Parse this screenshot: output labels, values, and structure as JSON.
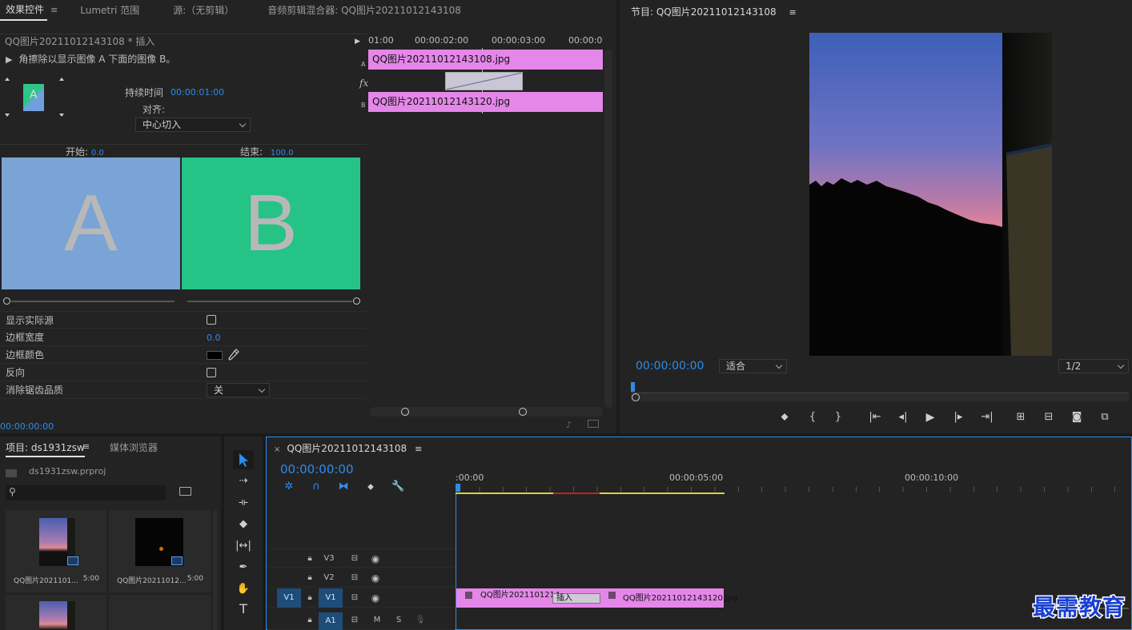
{
  "effect_panel": {
    "tabs": [
      "效果控件",
      "Lumetri 范围",
      "源:（无剪辑）",
      "音频剪辑混合器: QQ图片20211012143108"
    ],
    "menu_icon": "hamburger-icon",
    "clip_header": "QQ图片20211012143108 * 插入",
    "description": "角擦除以显示图像 A 下面的图像 B。",
    "duration_label": "持续时间",
    "duration_value": "00:00:01:00",
    "align_label": "对齐:",
    "align_value": "中心切入",
    "start_label": "开始:",
    "start_value": "0.0",
    "end_label": "结束:",
    "end_value": "100.0",
    "preview_a": "A",
    "preview_b": "B",
    "show_actual_label": "显示实际源",
    "border_width_label": "边框宽度",
    "border_width_value": "0.0",
    "border_color_label": "边框颜色",
    "reverse_label": "反向",
    "antialias_label": "消除锯齿品质",
    "antialias_value": "关",
    "timecode": "00:00:00:00",
    "mini_ruler": [
      "01:00",
      "00:00:02:00",
      "00:00:03:00",
      "00:00:0"
    ],
    "track_a_label": "A",
    "track_b_label": "B",
    "fx_label": "fx",
    "clip_a": "QQ图片20211012143108.jpg",
    "clip_b": "QQ图片20211012143120.jpg"
  },
  "program_monitor": {
    "title": "节目: QQ图片20211012143108",
    "timecode": "00:00:00:00",
    "fit_value": "适合",
    "resolution_value": "1/2"
  },
  "project_panel": {
    "tabs": [
      "项目: ds1931zsw",
      "媒体浏览器"
    ],
    "file_name": "ds1931zsw.prproj",
    "search_placeholder": "",
    "items": [
      {
        "name": "QQ图片2021101...",
        "duration": "5:00"
      },
      {
        "name": "QQ图片20211012...",
        "duration": "5:00"
      }
    ]
  },
  "timeline": {
    "tab_title": "QQ图片20211012143108",
    "timecode": "00:00:00:00",
    "ruler": [
      ":00:00",
      "00:00:05:00",
      "00:00:10:00"
    ],
    "tracks": [
      {
        "source": "",
        "name": "V3"
      },
      {
        "source": "",
        "name": "V2"
      },
      {
        "source": "V1",
        "name": "V1"
      },
      {
        "source": "",
        "name": "A1",
        "m": "M",
        "s": "S"
      }
    ],
    "clip1": "QQ图片2021101214",
    "transition": "插入",
    "clip2": "QQ图片20211012143120.jpg"
  },
  "watermark": "最需教育",
  "colors": {
    "accent": "#2d8ceb",
    "clip": "#e487e8",
    "preview_a": "#7ba4d6",
    "preview_b": "#26c386"
  }
}
